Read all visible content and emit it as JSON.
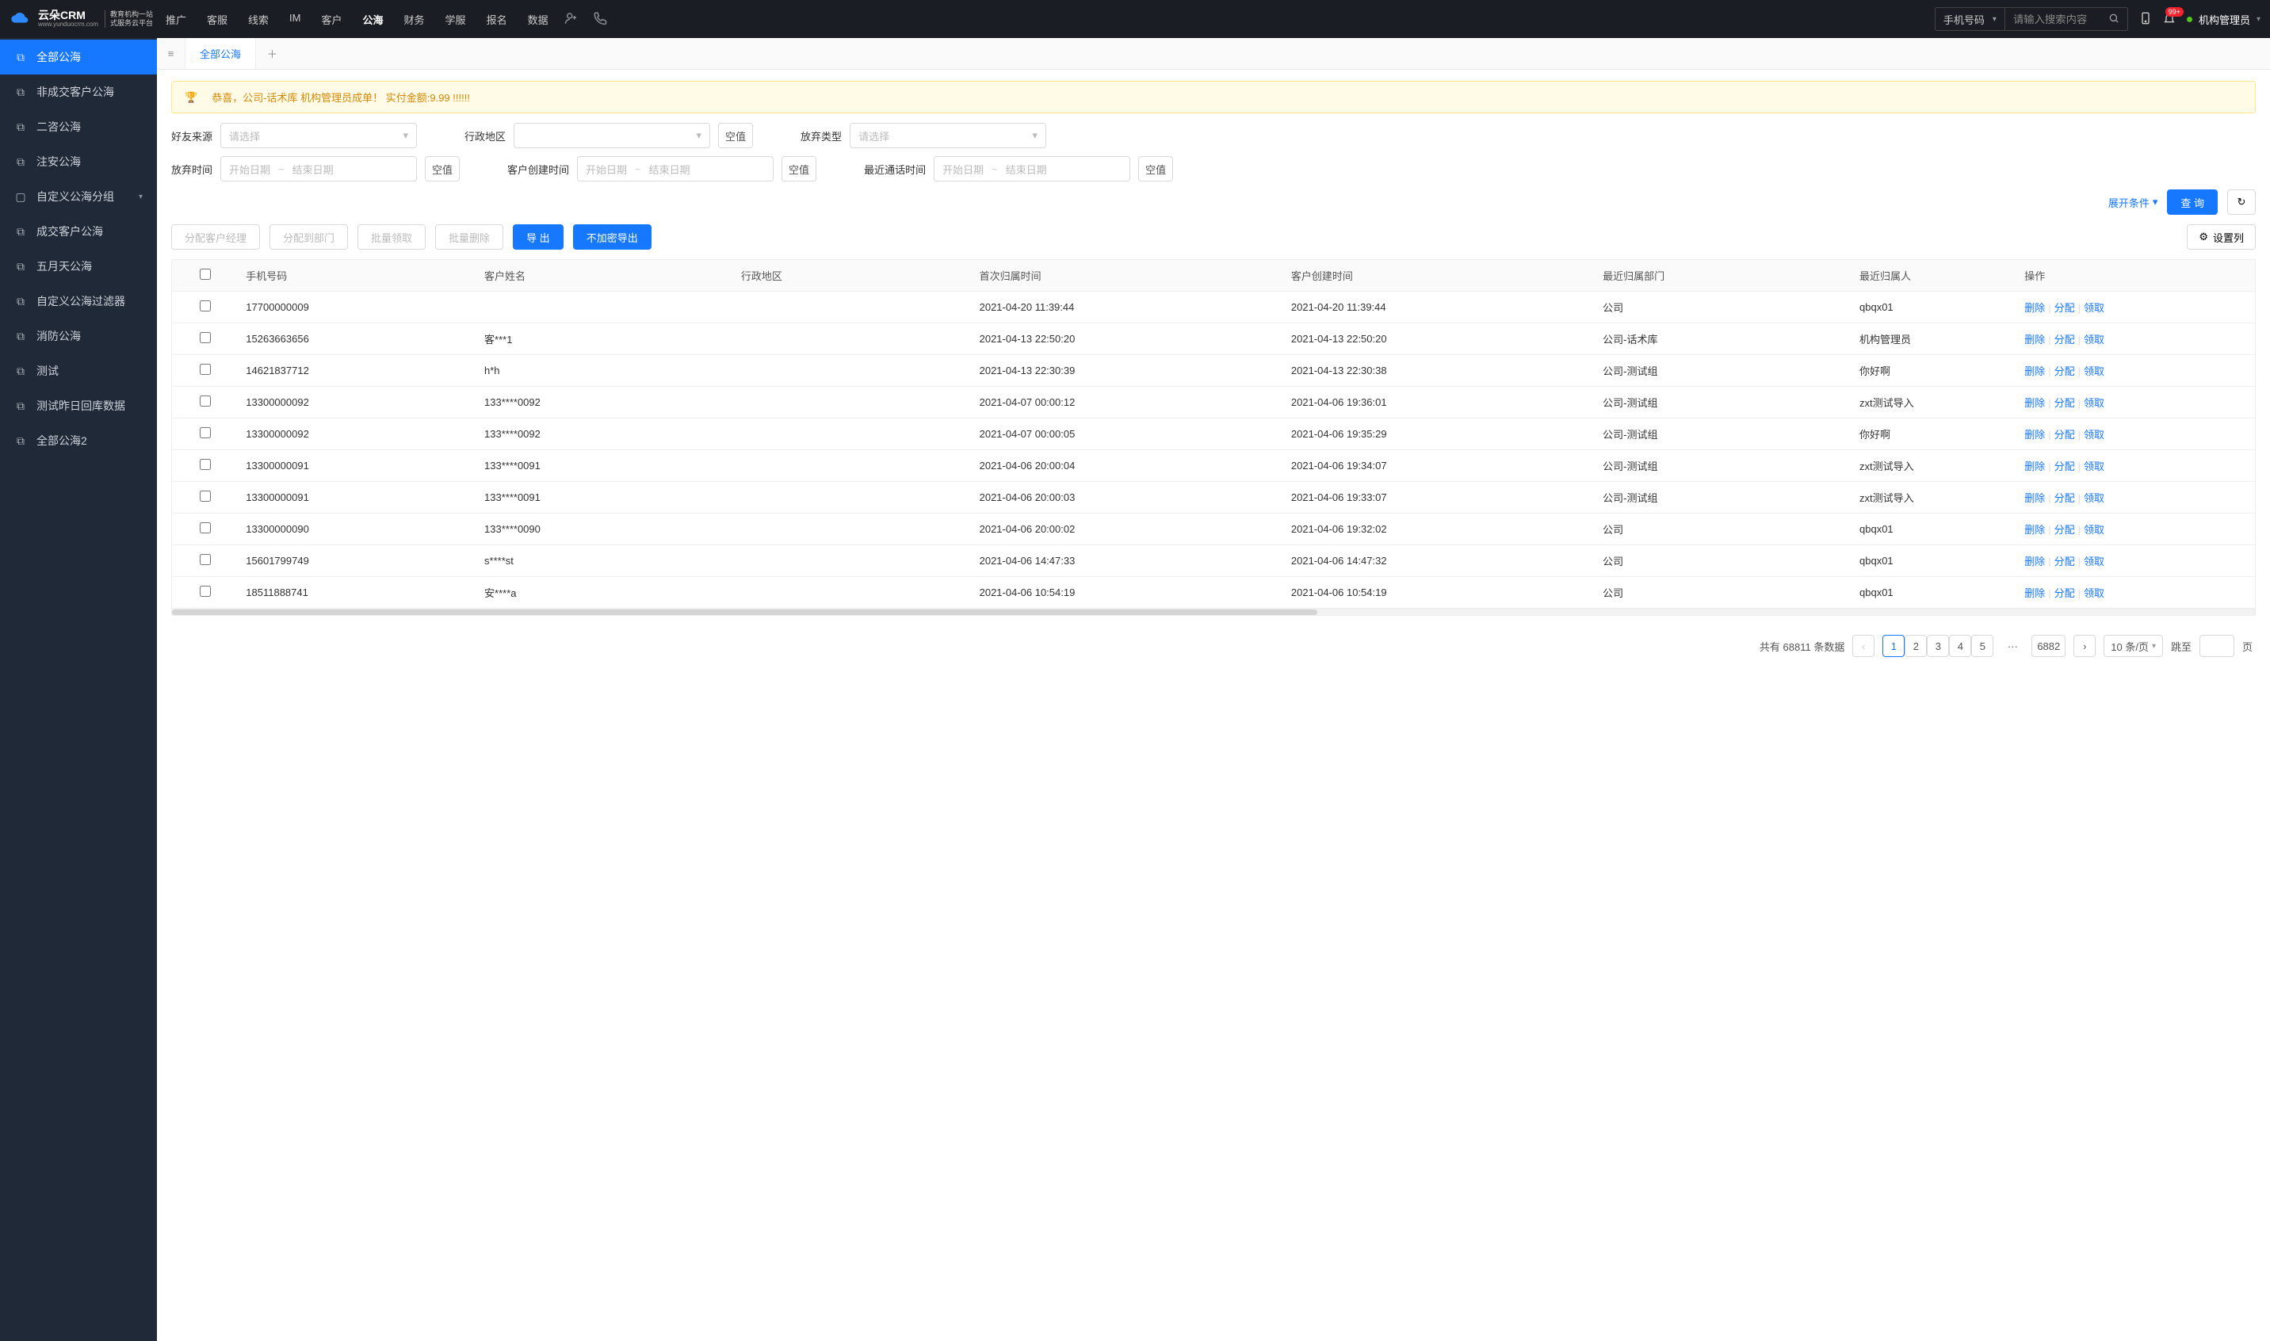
{
  "brand": {
    "name": "云朵CRM",
    "domain": "www.yunduocrm.com",
    "tagline1": "教育机构一站",
    "tagline2": "式服务云平台"
  },
  "nav": {
    "items": [
      "推广",
      "客服",
      "线索",
      "IM",
      "客户",
      "公海",
      "财务",
      "学服",
      "报名",
      "数据"
    ],
    "active": "公海"
  },
  "search": {
    "type": "手机号码",
    "placeholder": "请输入搜索内容"
  },
  "notifications": {
    "count": "99+"
  },
  "user": {
    "name": "机构管理员"
  },
  "sidebar": {
    "items": [
      {
        "icon": "⧉",
        "label": "全部公海",
        "active": true
      },
      {
        "icon": "⧉",
        "label": "非成交客户公海"
      },
      {
        "icon": "⧉",
        "label": "二咨公海"
      },
      {
        "icon": "⧉",
        "label": "注安公海"
      },
      {
        "icon": "▢",
        "label": "自定义公海分组",
        "chev": true
      },
      {
        "icon": "⧉",
        "label": "成交客户公海"
      },
      {
        "icon": "⧉",
        "label": "五月天公海"
      },
      {
        "icon": "⧉",
        "label": "自定义公海过滤器"
      },
      {
        "icon": "⧉",
        "label": "消防公海"
      },
      {
        "icon": "⧉",
        "label": "测试"
      },
      {
        "icon": "⧉",
        "label": "测试昨日回库数据"
      },
      {
        "icon": "⧉",
        "label": "全部公海2"
      }
    ]
  },
  "tabs": {
    "active": "全部公海"
  },
  "banner": "恭喜，公司-话术库  机构管理员成单！  实付金额:9.99 !!!!!!",
  "filters": {
    "friendSource": {
      "label": "好友来源",
      "placeholder": "请选择"
    },
    "region": {
      "label": "行政地区",
      "null": "空值"
    },
    "abandonType": {
      "label": "放弃类型",
      "placeholder": "请选择"
    },
    "abandonTime": {
      "label": "放弃时间",
      "start": "开始日期",
      "end": "结束日期",
      "null": "空值"
    },
    "createTime": {
      "label": "客户创建时间",
      "start": "开始日期",
      "end": "结束日期",
      "null": "空值"
    },
    "lastCallTime": {
      "label": "最近通话时间",
      "start": "开始日期",
      "end": "结束日期",
      "null": "空值"
    },
    "expand": "展开条件",
    "query": "查 询"
  },
  "toolbar": {
    "assignMgr": "分配客户经理",
    "assignDept": "分配到部门",
    "batchClaim": "批量领取",
    "batchDelete": "批量删除",
    "export": "导 出",
    "exportPlain": "不加密导出",
    "cols": "设置列"
  },
  "table": {
    "headers": [
      "手机号码",
      "客户姓名",
      "行政地区",
      "首次归属时间",
      "客户创建时间",
      "最近归属部门",
      "最近归属人",
      "操作"
    ],
    "ops": {
      "del": "删除",
      "assign": "分配",
      "claim": "领取"
    },
    "rows": [
      {
        "phone": "17700000009",
        "name": "",
        "region": "",
        "first": "2021-04-20 11:39:44",
        "created": "2021-04-20 11:39:44",
        "dept": "公司",
        "owner": "qbqx01"
      },
      {
        "phone": "15263663656",
        "name": "客***1",
        "region": "",
        "first": "2021-04-13 22:50:20",
        "created": "2021-04-13 22:50:20",
        "dept": "公司-话术库",
        "owner": "机构管理员"
      },
      {
        "phone": "14621837712",
        "name": "h*h",
        "region": "",
        "first": "2021-04-13 22:30:39",
        "created": "2021-04-13 22:30:38",
        "dept": "公司-测试组",
        "owner": "你好啊"
      },
      {
        "phone": "13300000092",
        "name": "133****0092",
        "region": "",
        "first": "2021-04-07 00:00:12",
        "created": "2021-04-06 19:36:01",
        "dept": "公司-测试组",
        "owner": "zxt测试导入"
      },
      {
        "phone": "13300000092",
        "name": "133****0092",
        "region": "",
        "first": "2021-04-07 00:00:05",
        "created": "2021-04-06 19:35:29",
        "dept": "公司-测试组",
        "owner": "你好啊"
      },
      {
        "phone": "13300000091",
        "name": "133****0091",
        "region": "",
        "first": "2021-04-06 20:00:04",
        "created": "2021-04-06 19:34:07",
        "dept": "公司-测试组",
        "owner": "zxt测试导入"
      },
      {
        "phone": "13300000091",
        "name": "133****0091",
        "region": "",
        "first": "2021-04-06 20:00:03",
        "created": "2021-04-06 19:33:07",
        "dept": "公司-测试组",
        "owner": "zxt测试导入"
      },
      {
        "phone": "13300000090",
        "name": "133****0090",
        "region": "",
        "first": "2021-04-06 20:00:02",
        "created": "2021-04-06 19:32:02",
        "dept": "公司",
        "owner": "qbqx01"
      },
      {
        "phone": "15601799749",
        "name": "s****st",
        "region": "",
        "first": "2021-04-06 14:47:33",
        "created": "2021-04-06 14:47:32",
        "dept": "公司",
        "owner": "qbqx01"
      },
      {
        "phone": "18511888741",
        "name": "安****a",
        "region": "",
        "first": "2021-04-06 10:54:19",
        "created": "2021-04-06 10:54:19",
        "dept": "公司",
        "owner": "qbqx01"
      }
    ]
  },
  "pager": {
    "totalPrefix": "共有",
    "total": "68811",
    "totalSuffix": "条数据",
    "pages": [
      "1",
      "2",
      "3",
      "4",
      "5"
    ],
    "ellipsis": "···",
    "last": "6882",
    "size": "10 条/页",
    "jumpPrefix": "跳至",
    "jumpSuffix": "页"
  }
}
